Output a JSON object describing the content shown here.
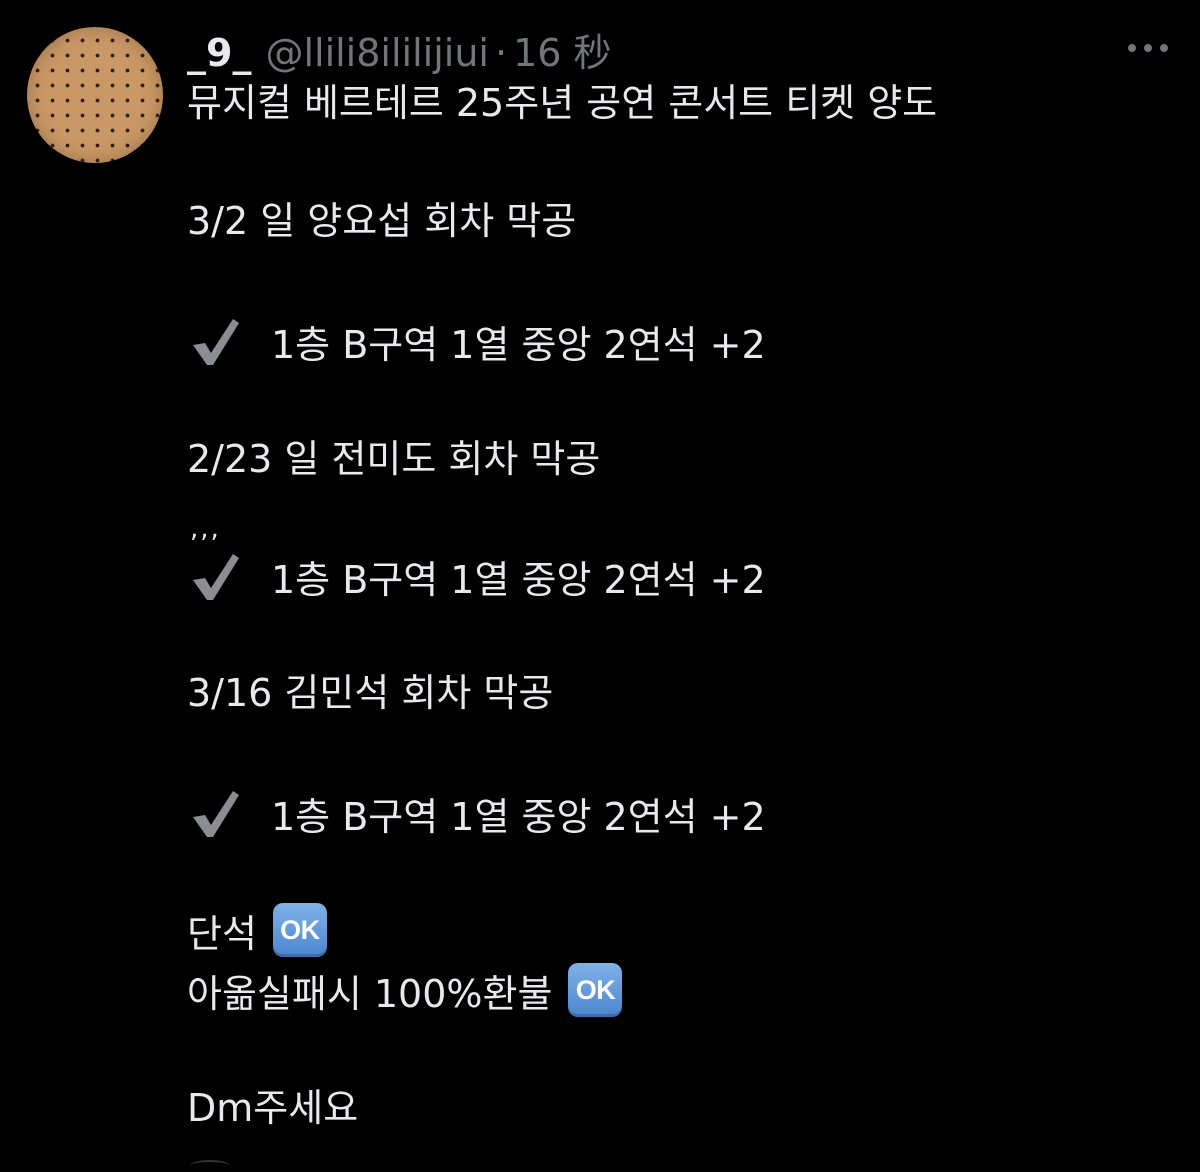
{
  "tweet": {
    "display_name": "_9_",
    "handle": "@llili8ililijiui",
    "separator": "·",
    "time": "16 秒",
    "lines": {
      "title": "뮤지컬 베르테르 25주년 공연 콘서트 티켓 양도",
      "show1": "3/2 일 양요섭 회차 막공",
      "seat1": "1층 B구역 1열 중앙 2연석 +2",
      "show2": "2/23 일 전미도 회차 막공",
      "quote_mark": ",,,",
      "seat2": "1층 B구역 1열 중앙 2연석 +2",
      "show3": "3/16 김민석 회차 막공",
      "seat3": "1층 B구역 1열 중앙 2연석 +2",
      "single": "단석",
      "refund": "아옮실패시 100%환불",
      "ok_label": "OK",
      "contact": "Dm주세요"
    },
    "icons": {
      "more": "more-horizontal-icon",
      "check": "heavy-check-mark-icon",
      "ok": "ok-button-emoji"
    },
    "colors": {
      "background": "#000000",
      "text": "#e7e9ea",
      "secondary": "#71767b",
      "ok_badge": "#5a93d6"
    }
  }
}
